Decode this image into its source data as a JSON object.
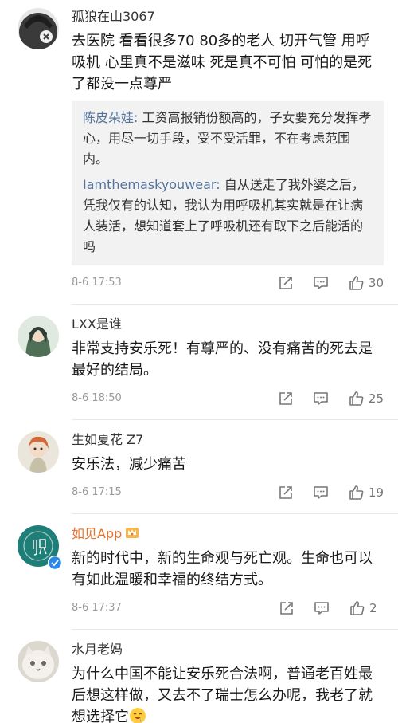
{
  "comments": [
    {
      "username": "孤狼在山3067",
      "text": "去医院 看看很多70 80多的老人 切开气管 用呼吸机 心里真不是滋味 死是真不可怕 可怕的是死了都没一点尊严",
      "replies": [
        {
          "user": "陈皮朵娃:",
          "text": " 工资高报销份额高的，子女要充分发挥孝心，用尽一切手段，受不受活罪，不在考虑范围内。"
        },
        {
          "user": "Iamthemaskyouwear:",
          "text": " 自从送走了我外婆之后，凭我仅有的认知，我认为用呼吸机其实就是在让病人装活，想知道套上了呼吸机还有取下之后能活的吗"
        }
      ],
      "time": "8-6 17:53",
      "likes": "30",
      "avatar_color": "#3a3a3a"
    },
    {
      "username": "LXX是谁",
      "text": "非常支持安乐死！有尊严的、没有痛苦的死去是最好的结局。",
      "time": "8-6 18:50",
      "likes": "25",
      "avatar_color": "#6f8f72"
    },
    {
      "username": "生如夏花 Z7",
      "text": "安乐法，减少痛苦",
      "time": "8-6 17:15",
      "likes": "19",
      "avatar_color": "#d98a4a"
    },
    {
      "username": "如见App",
      "text": "新的时代中，新的生命观与死亡观。生命也可以有如此温暖和幸福的终结方式。",
      "time": "8-6 17:37",
      "likes": "2",
      "avatar_color": "#1e7f78",
      "avatar_text": "如见",
      "username_color": "#e8702a"
    },
    {
      "username": "水月老妈",
      "text": "为什么中国不能让安乐死合法啊，普通老百姓最后想这样做，又去不了瑞士怎么办呢，我老了就想选择它",
      "avatar_color": "#b9b2a6"
    }
  ],
  "icons": {
    "share": "share-icon",
    "reply": "comment-icon",
    "like": "thumbs-up-icon",
    "vip_badge": "crown-badge-icon",
    "verified": "verified-icon",
    "emoji": "drooling-face-emoji"
  },
  "colors": {
    "reply_user": "#53739c",
    "meta": "#9a9a9a",
    "reply_bg": "#f2f2f2"
  }
}
